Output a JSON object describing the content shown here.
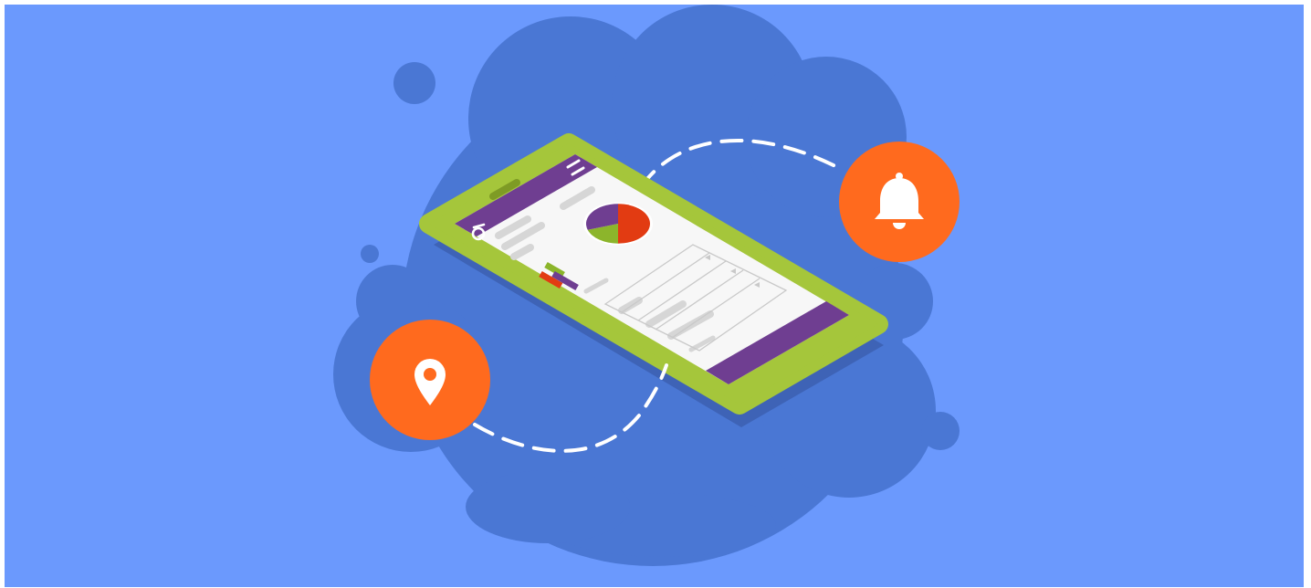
{
  "colors": {
    "page_border": "#FFFFFF",
    "background": "#6B99FD",
    "blob": "#4A77D4",
    "phone_body": "#A5C63B",
    "phone_shadow": "#3E63B6",
    "screen": "#F7F7F7",
    "header_purple": "#6F3E91",
    "accent_orange": "#FF6A1E",
    "pie_red": "#E23B12",
    "pie_green": "#8CB52B",
    "pie_purple": "#6F3E91",
    "placeholder_gray": "#D6D6D6",
    "table_border": "#C9C9C9",
    "dashed_path": "#FFFFFF",
    "icon_white": "#FFFFFF"
  },
  "icons": {
    "notification": "bell-icon",
    "location": "map-pin-icon",
    "app_logo": "app-logo-icon",
    "menu": "hamburger-menu-icon",
    "sort": "sort-arrow-icon"
  },
  "illustration": {
    "phone_chart": {
      "type": "pie",
      "slices": [
        {
          "name": "red",
          "value": 0.5
        },
        {
          "name": "green",
          "value": 0.2
        },
        {
          "name": "purple",
          "value": 0.3
        }
      ]
    },
    "mini_bars": [
      {
        "name": "green",
        "value": 0.55
      },
      {
        "name": "purple",
        "value": 0.75
      },
      {
        "name": "red",
        "value": 0.65
      }
    ]
  }
}
